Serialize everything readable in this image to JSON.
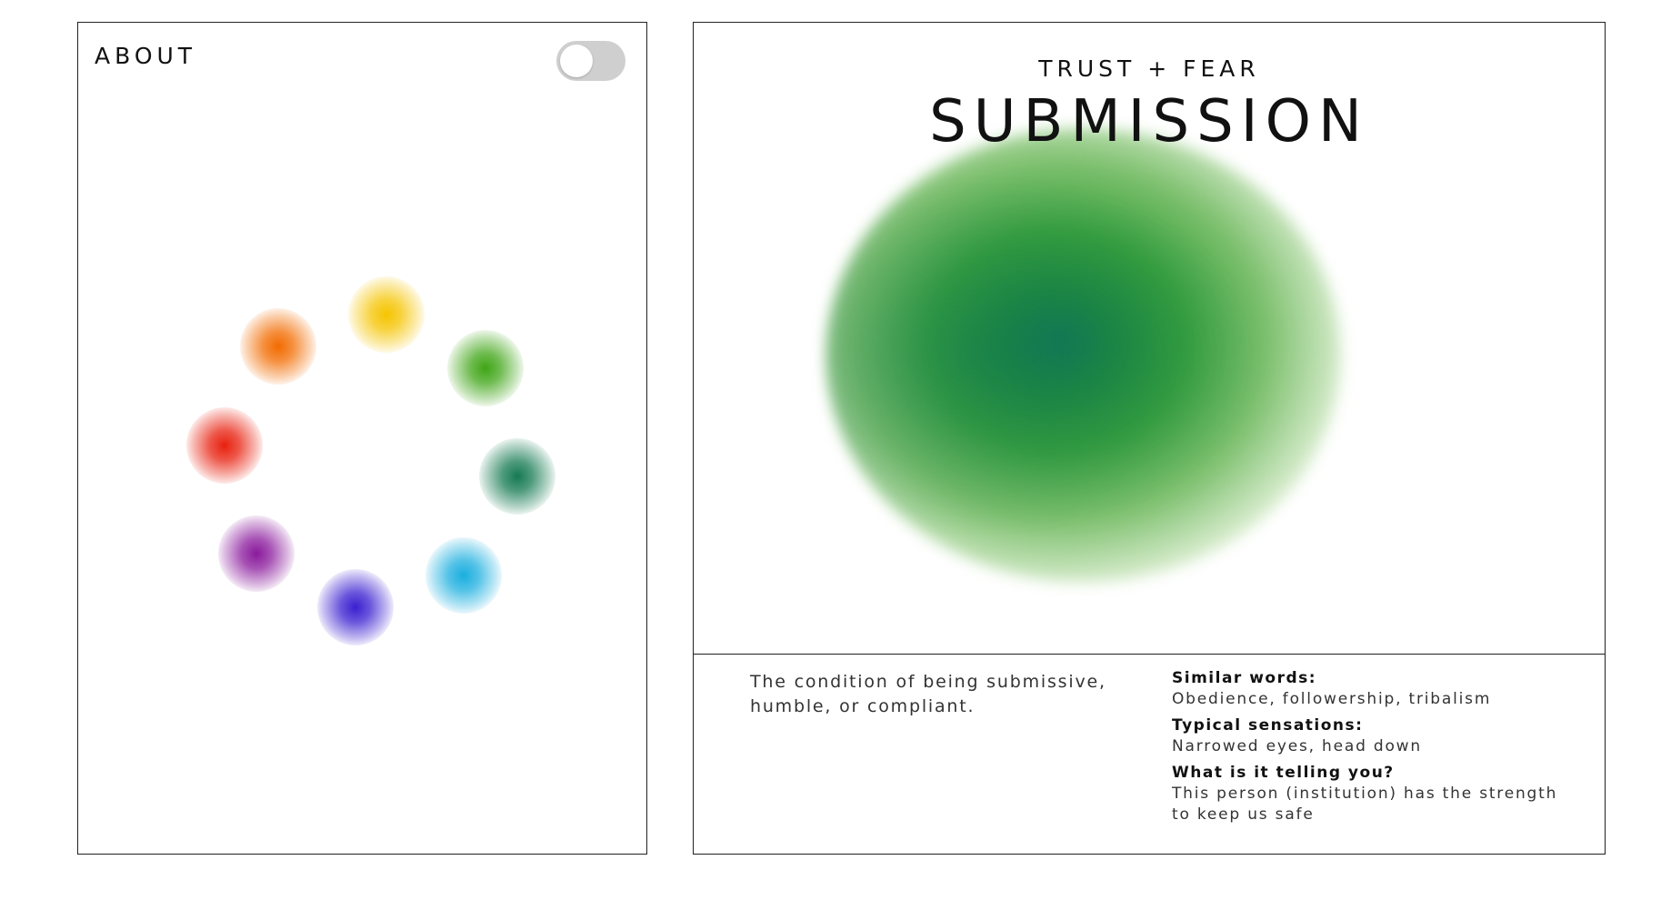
{
  "about": {
    "title": "ABOUT",
    "toggle_on": false
  },
  "wheel": {
    "dots": [
      {
        "name": "yellow",
        "color": "#f5c400"
      },
      {
        "name": "light-green",
        "color": "#3fa516"
      },
      {
        "name": "dark-green",
        "color": "#157a52"
      },
      {
        "name": "light-blue",
        "color": "#1aaedf"
      },
      {
        "name": "dark-blue",
        "color": "#3a1fd0"
      },
      {
        "name": "purple",
        "color": "#8a1a9c"
      },
      {
        "name": "red",
        "color": "#e8200e"
      },
      {
        "name": "orange",
        "color": "#f26b00"
      }
    ]
  },
  "emotion": {
    "pair": "TRUST + FEAR",
    "name": "SUBMISSION",
    "definition": "The condition of being submissive, humble, or compliant.",
    "similar_label": "Similar words:",
    "similar_value": "Obedience, followership, tribalism",
    "sensations_label": "Typical sensations:",
    "sensations_value": "Narrowed eyes, head down",
    "telling_label": "What is it telling you?",
    "telling_value": "This person (institution) has the strength to keep us safe",
    "colors": [
      "#147a54",
      "#37a03d"
    ]
  }
}
